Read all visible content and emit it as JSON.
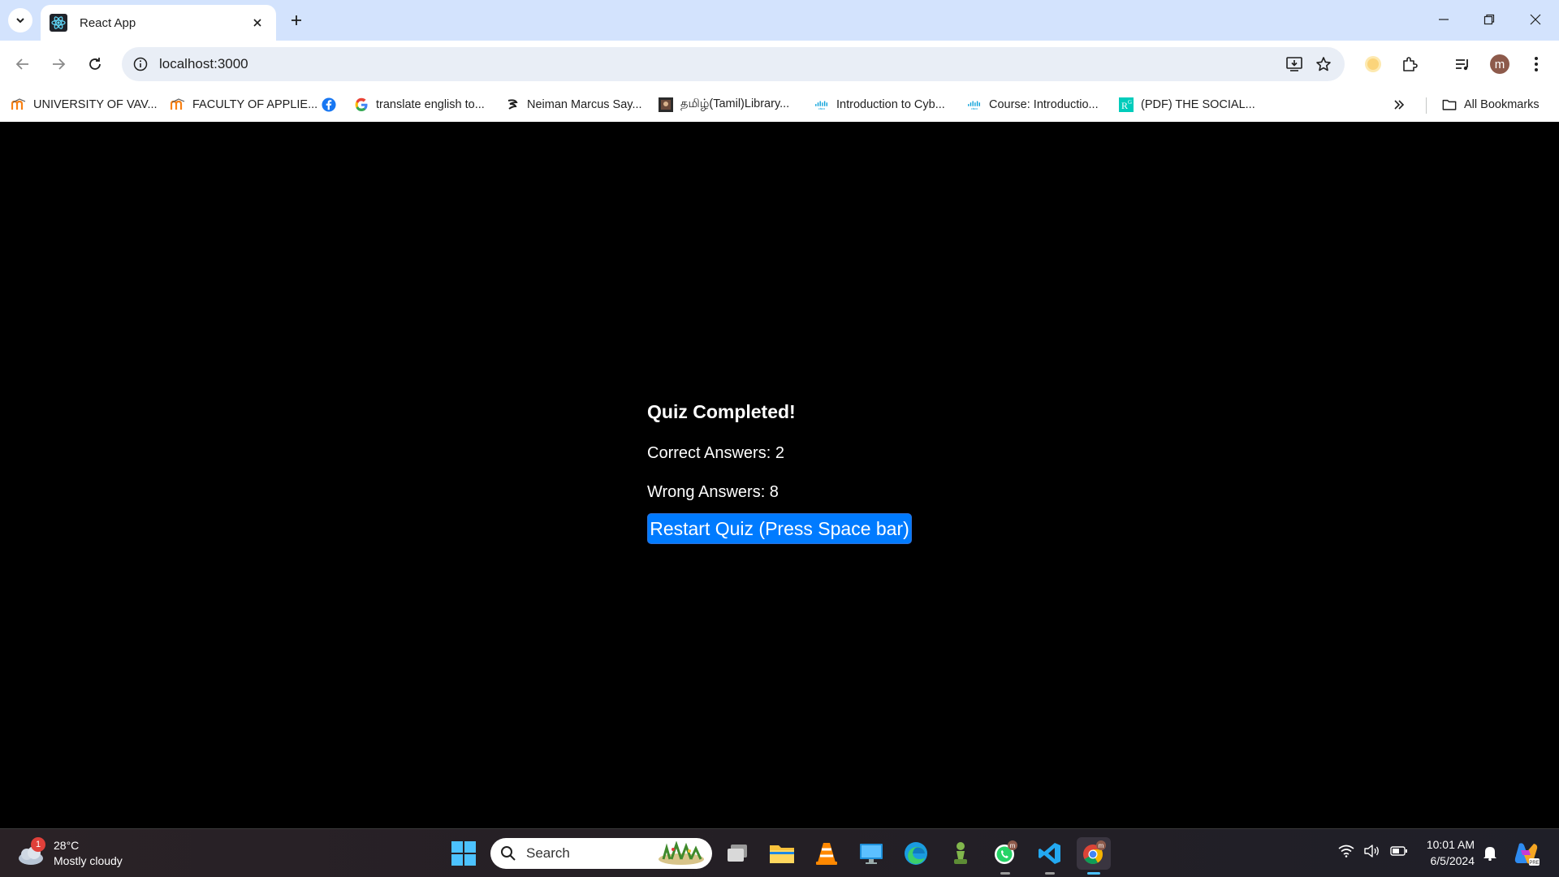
{
  "browser": {
    "tab_title": "React App",
    "url": "localhost:3000",
    "bookmarks": [
      {
        "label": "UNIVERSITY OF VAV...",
        "icon": "moodle-icon"
      },
      {
        "label": "FACULTY OF APPLIE...",
        "icon": "moodle-icon"
      },
      {
        "label": "",
        "icon": "facebook-icon"
      },
      {
        "label": "translate english to...",
        "icon": "google-icon"
      },
      {
        "label": "Neiman Marcus Say...",
        "icon": "neiman-icon"
      },
      {
        "label": "தமிழ்(Tamil)Library...",
        "icon": "library-icon"
      },
      {
        "label": "Introduction to Cyb...",
        "icon": "cisco-icon"
      },
      {
        "label": "Course: Introductio...",
        "icon": "cisco-icon"
      },
      {
        "label": "(PDF) THE SOCIAL...",
        "icon": "researchgate-icon"
      }
    ],
    "all_bookmarks_label": "All Bookmarks",
    "profile_initial": "m"
  },
  "quiz": {
    "title": "Quiz Completed!",
    "correct_text": "Correct Answers: 2",
    "wrong_text": "Wrong Answers: 8",
    "restart_label": "Restart Quiz (Press Space bar)",
    "correct": 2,
    "wrong": 8
  },
  "taskbar": {
    "weather_temp": "28°C",
    "weather_desc": "Mostly cloudy",
    "weather_badge": "1",
    "search_placeholder": "Search",
    "time": "10:01 AM",
    "date": "6/5/2024"
  },
  "colors": {
    "tabstrip": "#d3e3fd",
    "accent_button": "#007bff",
    "page_bg": "#000000"
  }
}
